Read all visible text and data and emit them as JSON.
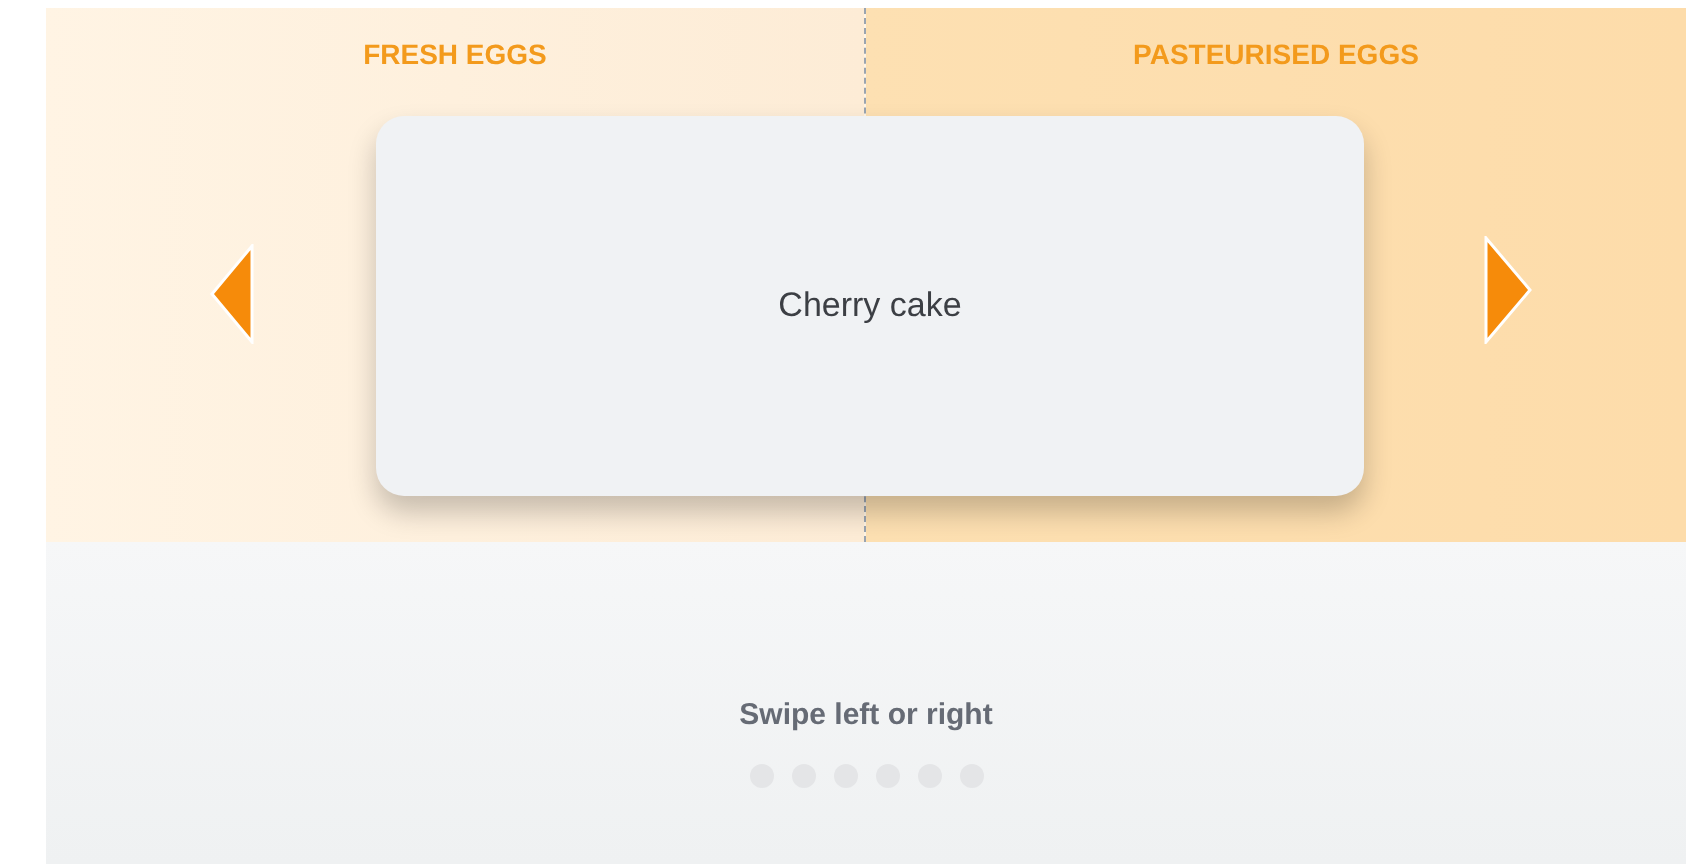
{
  "categories": [
    {
      "label": "FRESH EGGS"
    },
    {
      "label": "PASTEURISED EGGS"
    }
  ],
  "card": {
    "text": "Cherry cake"
  },
  "hint": "Swipe left or right",
  "dots": [
    {
      "selected": false
    },
    {
      "selected": false
    },
    {
      "selected": false
    },
    {
      "selected": false
    },
    {
      "selected": false
    },
    {
      "selected": false
    }
  ]
}
